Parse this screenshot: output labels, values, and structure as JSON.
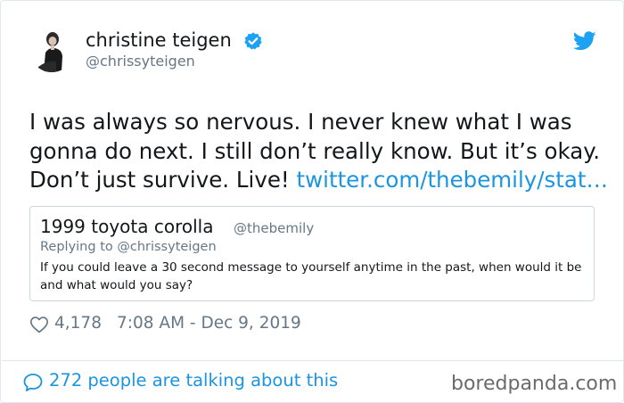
{
  "author": {
    "name": "christine teigen",
    "handle": "@chrissyteigen",
    "verified": true
  },
  "tweet": {
    "lines": [
      "I was always so nervous. I never knew what I was",
      "gonna do next. I still don’t really know. But it’s okay.",
      "Don’t just survive. Live! "
    ],
    "link_text": "twitter.com/thebemily/stat…"
  },
  "quoted_tweet": {
    "name": "1999 toyota corolla",
    "handle": "@thebemily",
    "replying_to": "Replying to @chrissyteigen",
    "text": "If you could leave a 30 second message to yourself anytime in the past, when would it be and what would you say?"
  },
  "stats": {
    "likes": "4,178",
    "timestamp": "7:08 AM - Dec 9, 2019"
  },
  "footer": {
    "talking": "272 people are talking about this",
    "watermark": "boredpanda.com"
  },
  "colors": {
    "accent": "#1b95e0",
    "text": "#14171a",
    "muted": "#657786",
    "border": "#e1e8ed"
  },
  "icons": [
    "avatar-photo",
    "verified-badge-icon",
    "twitter-bird-icon",
    "heart-icon",
    "speech-bubble-icon"
  ]
}
